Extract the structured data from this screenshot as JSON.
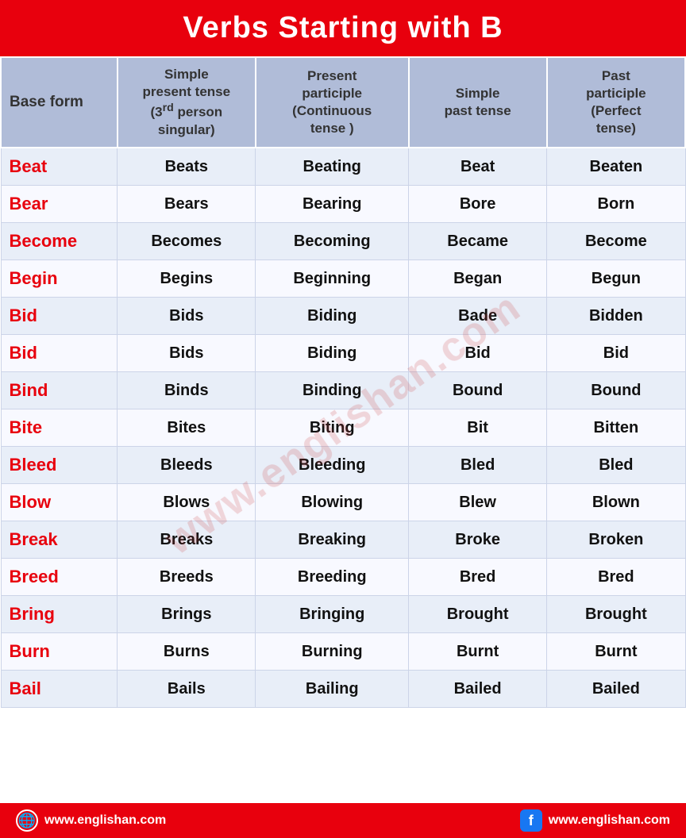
{
  "title": "Verbs Starting with B",
  "header": {
    "col0": "Base form",
    "col1_line1": "Simple present tense",
    "col1_line2": "(3rd person singular)",
    "col2_line1": "Present participle",
    "col2_line2": "(Continuous tense )",
    "col3_line1": "Simple",
    "col3_line2": "past tense",
    "col4_line1": "Past participle",
    "col4_line2": "(Perfect tense)"
  },
  "rows": [
    [
      "Beat",
      "Beats",
      "Beating",
      "Beat",
      "Beaten"
    ],
    [
      "Bear",
      "Bears",
      "Bearing",
      "Bore",
      "Born"
    ],
    [
      "Become",
      "Becomes",
      "Becoming",
      "Became",
      "Become"
    ],
    [
      "Begin",
      "Begins",
      "Beginning",
      "Began",
      "Begun"
    ],
    [
      "Bid",
      "Bids",
      "Biding",
      "Bade",
      "Bidden"
    ],
    [
      "Bid",
      "Bids",
      "Biding",
      "Bid",
      "Bid"
    ],
    [
      "Bind",
      "Binds",
      "Binding",
      "Bound",
      "Bound"
    ],
    [
      "Bite",
      "Bites",
      "Biting",
      "Bit",
      "Bitten"
    ],
    [
      "Bleed",
      "Bleeds",
      "Bleeding",
      "Bled",
      "Bled"
    ],
    [
      "Blow",
      "Blows",
      "Blowing",
      "Blew",
      "Blown"
    ],
    [
      "Break",
      "Breaks",
      "Breaking",
      "Broke",
      "Broken"
    ],
    [
      "Breed",
      "Breeds",
      "Breeding",
      "Bred",
      "Bred"
    ],
    [
      "Bring",
      "Brings",
      "Bringing",
      "Brought",
      "Brought"
    ],
    [
      "Burn",
      "Burns",
      "Burning",
      "Burnt",
      "Burnt"
    ],
    [
      "Bail",
      "Bails",
      "Bailing",
      "Bailed",
      "Bailed"
    ]
  ],
  "watermark": "www.englishan.com",
  "footer": {
    "left_url": "www.englishan.com",
    "right_url": "www.englishan.com"
  }
}
